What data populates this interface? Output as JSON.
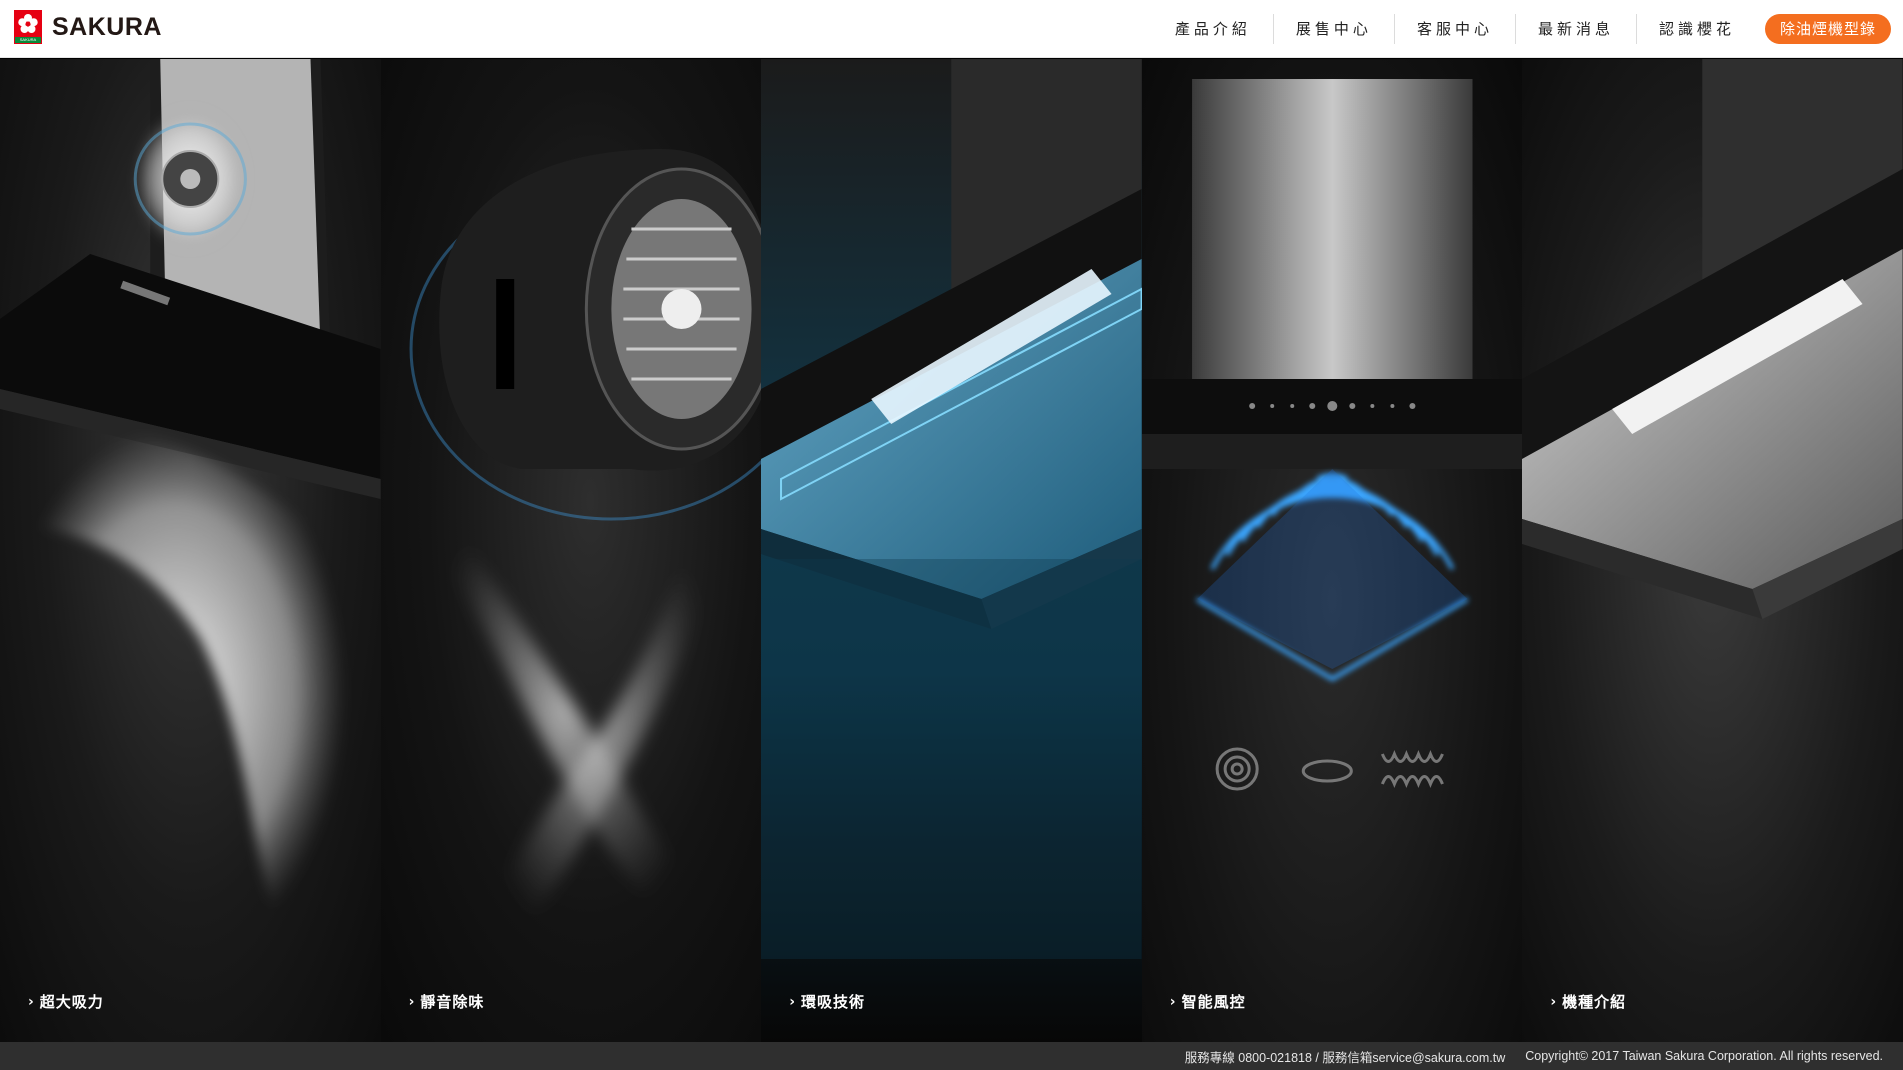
{
  "brand": {
    "name": "SAKURA",
    "mark_text": "SAKURA",
    "color": "#e60012"
  },
  "nav": {
    "items": [
      "產品介紹",
      "展售中心",
      "客服中心",
      "最新消息",
      "認識櫻花"
    ],
    "cta": "除油煙機型錄",
    "cta_color": "#f46e1f"
  },
  "panels": [
    {
      "label": "超大吸力",
      "icon": "chevron-right-icon"
    },
    {
      "label": "靜音除味",
      "icon": "chevron-right-icon"
    },
    {
      "label": "環吸技術",
      "icon": "chevron-right-icon"
    },
    {
      "label": "智能風控",
      "icon": "chevron-right-icon"
    },
    {
      "label": "機種介紹",
      "icon": "chevron-right-icon"
    }
  ],
  "footer": {
    "contact": "服務專線 0800-021818 / 服務信箱service@sakura.com.tw",
    "copyright": "Copyright© 2017 Taiwan Sakura Corporation. All rights reserved."
  }
}
